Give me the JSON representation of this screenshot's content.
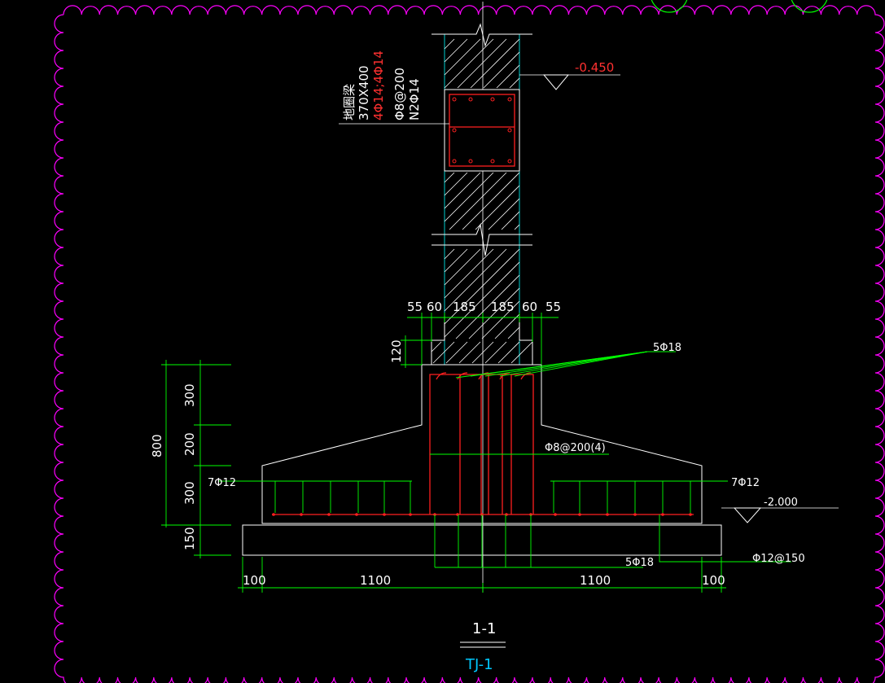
{
  "drawing": {
    "elevations": {
      "top": "-0.450",
      "bottom": "-2.000"
    },
    "ground_beam": {
      "name": "地圈梁",
      "size": "370X400",
      "top_bottom_bars": "4Φ14;4Φ14",
      "stirrups": "Φ8@200",
      "side_bars": "N2Φ14"
    },
    "top_dims": [
      "55",
      "60",
      "185",
      "185",
      "60",
      "55"
    ],
    "step_dim": "120",
    "left_dims": {
      "total": "800",
      "seg1": "300",
      "seg2": "200",
      "seg3": "300",
      "seg4": "150"
    },
    "bottom_dims": [
      "100",
      "1100",
      "1100",
      "100"
    ],
    "labels": {
      "dowel": "5Φ18",
      "stirrup_ring": "Φ8@200(4)",
      "left_bars": "7Φ12",
      "right_bars": "7Φ12",
      "bottom_dowel": "5Φ18",
      "bottom_mesh": "Φ12@150"
    },
    "section_title": "1-1",
    "section_subtitle": "TJ-1",
    "colors": {
      "concrete": "#ffffff",
      "column": "#00cccc",
      "rebar": "#ff2020",
      "dimension": "#00ff00",
      "revision_cloud": "#ff00ff",
      "subtitle": "#00c8ff"
    }
  }
}
